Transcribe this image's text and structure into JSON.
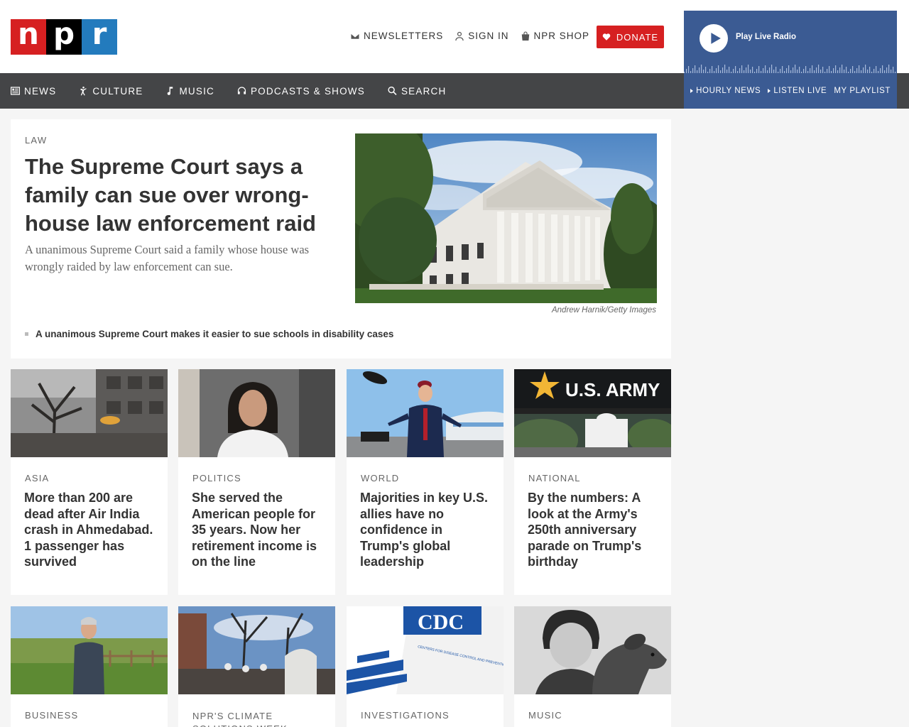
{
  "logo": {
    "letters": [
      "n",
      "p",
      "r"
    ]
  },
  "header": {
    "links": [
      {
        "label": "NEWSLETTERS",
        "icon": "envelope-icon"
      },
      {
        "label": "SIGN IN",
        "icon": "user-icon"
      },
      {
        "label": "NPR SHOP",
        "icon": "shopping-bag-icon"
      }
    ],
    "donate_label": "DONATE"
  },
  "player": {
    "label": "Play Live Radio",
    "links": [
      "HOURLY NEWS",
      "LISTEN LIVE",
      "MY PLAYLIST"
    ]
  },
  "nav": {
    "items": [
      {
        "label": "NEWS",
        "icon": "news-icon"
      },
      {
        "label": "CULTURE",
        "icon": "culture-icon"
      },
      {
        "label": "MUSIC",
        "icon": "music-note-icon"
      },
      {
        "label": "PODCASTS & SHOWS",
        "icon": "headphones-icon"
      },
      {
        "label": "SEARCH",
        "icon": "search-icon"
      }
    ]
  },
  "featured": {
    "slug": "LAW",
    "title": "The Supreme Court says a family can sue over wrong-house law enforcement raid",
    "teaser": "A unanimous Supreme Court said a family whose house was wrongly raided by law enforcement can sue.",
    "credit": "Andrew Harnik/Getty Images",
    "related": "A unanimous Supreme Court makes it easier to sue schools in disability cases"
  },
  "cards_row1": [
    {
      "slug": "ASIA",
      "title": "More than 200 are dead after Air India crash in Ahmedabad. 1 passenger has survived"
    },
    {
      "slug": "POLITICS",
      "title": "She served the American people for 35 years. Now her retirement income is on the line"
    },
    {
      "slug": "WORLD",
      "title": "Majorities in key U.S. allies have no confidence in Trump's global leadership"
    },
    {
      "slug": "NATIONAL",
      "title": "By the numbers: A look at the Army's 250th anniversary parade on Trump's birthday",
      "image_text": "U.S. ARMY"
    }
  ],
  "cards_row2": [
    {
      "slug": "BUSINESS"
    },
    {
      "slug": "NPR'S CLIMATE SOLUTIONS WEEK"
    },
    {
      "slug": "INVESTIGATIONS",
      "image_text": "CDC",
      "image_subtext": "CENTERS FOR DISEASE CONTROL AND PREVENTION"
    },
    {
      "slug": "MUSIC"
    }
  ],
  "colors": {
    "npr_red": "#d62021",
    "npr_blue": "#237bbd",
    "player_blue": "#3b5b93",
    "nav_gray": "#444547"
  }
}
